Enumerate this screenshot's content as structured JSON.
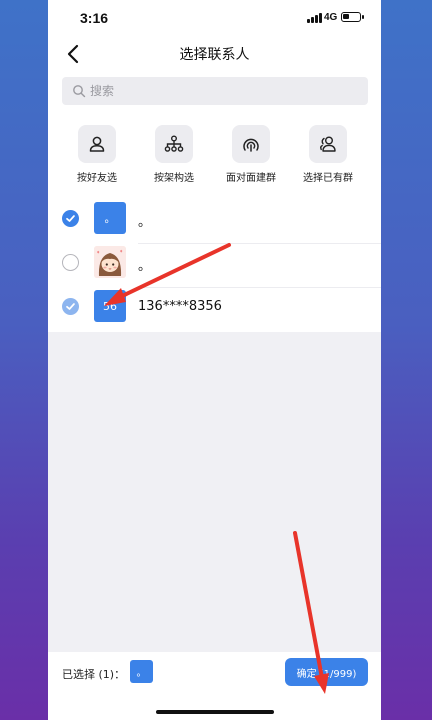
{
  "status_bar": {
    "time": "3:16",
    "network": "4G"
  },
  "header": {
    "title": "选择联系人"
  },
  "search": {
    "placeholder": "搜索",
    "value": ""
  },
  "quick_actions": [
    {
      "label": "按好友选",
      "icon": "person-icon"
    },
    {
      "label": "按架构选",
      "icon": "org-chart-icon"
    },
    {
      "label": "面对面建群",
      "icon": "nearby-signal-icon"
    },
    {
      "label": "选择已有群",
      "icon": "group-icon"
    }
  ],
  "contacts": [
    {
      "avatar_text": "。",
      "name": "。",
      "checked": true
    },
    {
      "avatar_text": "",
      "name": "。",
      "checked": false
    },
    {
      "avatar_text": "56",
      "name": "136****8356",
      "checked": true
    }
  ],
  "footer": {
    "selected_label": "已选择 (1)：",
    "selected_avatar_text": "。",
    "confirm_label": "确定 (1/999)"
  },
  "colors": {
    "accent": "#3b82e8",
    "annotation_arrow": "#e8342a"
  }
}
